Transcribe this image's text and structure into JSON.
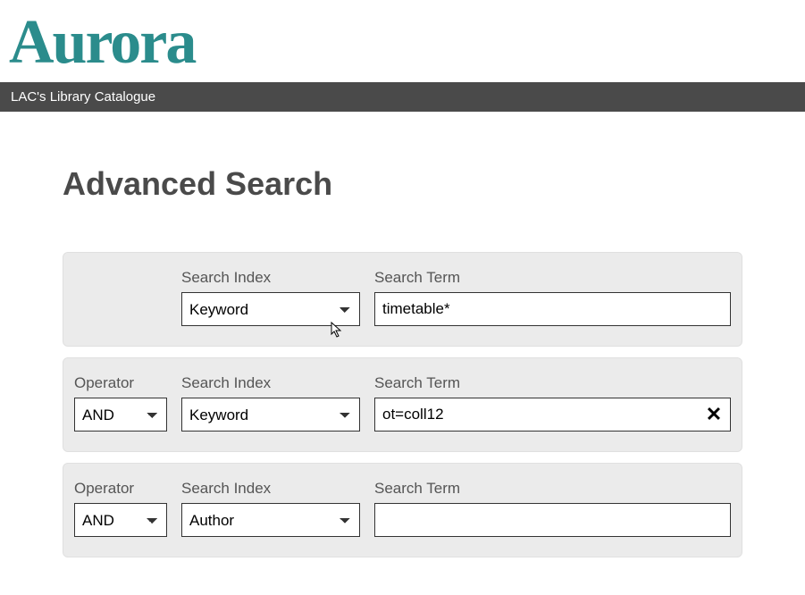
{
  "logo": {
    "text": "Aurora"
  },
  "nav": {
    "title": "LAC's Library Catalogue"
  },
  "page": {
    "title": "Advanced Search"
  },
  "labels": {
    "operator": "Operator",
    "search_index": "Search Index",
    "search_term": "Search Term"
  },
  "rows": [
    {
      "index_selected": "Keyword",
      "term_value": "timetable*",
      "show_clear": false
    },
    {
      "operator_selected": "AND",
      "index_selected": "Keyword",
      "term_value": "ot=coll12",
      "show_clear": true
    },
    {
      "operator_selected": "AND",
      "index_selected": "Author",
      "term_value": "",
      "show_clear": false
    }
  ],
  "icons": {
    "clear_glyph": "✕"
  }
}
